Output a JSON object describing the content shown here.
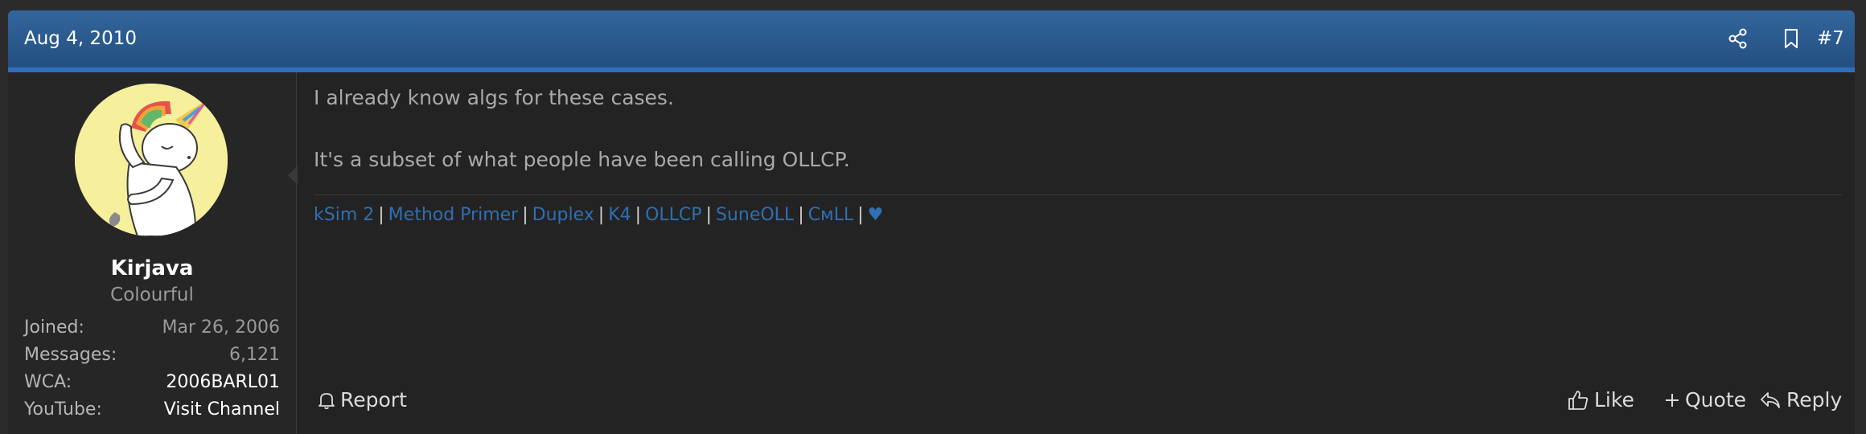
{
  "post": {
    "date": "Aug 4, 2010",
    "number": "#7"
  },
  "user": {
    "name": "Kirjava",
    "title": "Colourful",
    "stats": [
      {
        "label": "Joined:",
        "value": "Mar 26, 2006"
      },
      {
        "label": "Messages:",
        "value": "6,121"
      },
      {
        "label": "WCA:",
        "value": "2006BARL01"
      },
      {
        "label": "YouTube:",
        "value": "Visit Channel"
      }
    ]
  },
  "message": {
    "line1": "I already know algs for these cases.",
    "line2": "It's a subset of what people have been calling OLLCP."
  },
  "signature": {
    "links": [
      "kSim 2",
      "Method Primer",
      "Duplex",
      "K4",
      "OLLCP",
      "SuneOLL",
      "CᴍLL",
      "♥"
    ],
    "separator": "|"
  },
  "actions": {
    "report": "Report",
    "like": "Like",
    "quote": "Quote",
    "reply": "Reply"
  },
  "icons": {
    "share": "share-icon",
    "bookmark": "bookmark-icon",
    "report": "bell-icon",
    "like": "thumbs-up-icon",
    "quote": "plus-icon",
    "reply": "reply-arrow-icon"
  },
  "colors": {
    "header": "#2a5a8f",
    "accent_line": "#2f70bd",
    "link": "#2f6fb3",
    "background": "#232323",
    "avatar_bg": "#f6ef9c"
  }
}
